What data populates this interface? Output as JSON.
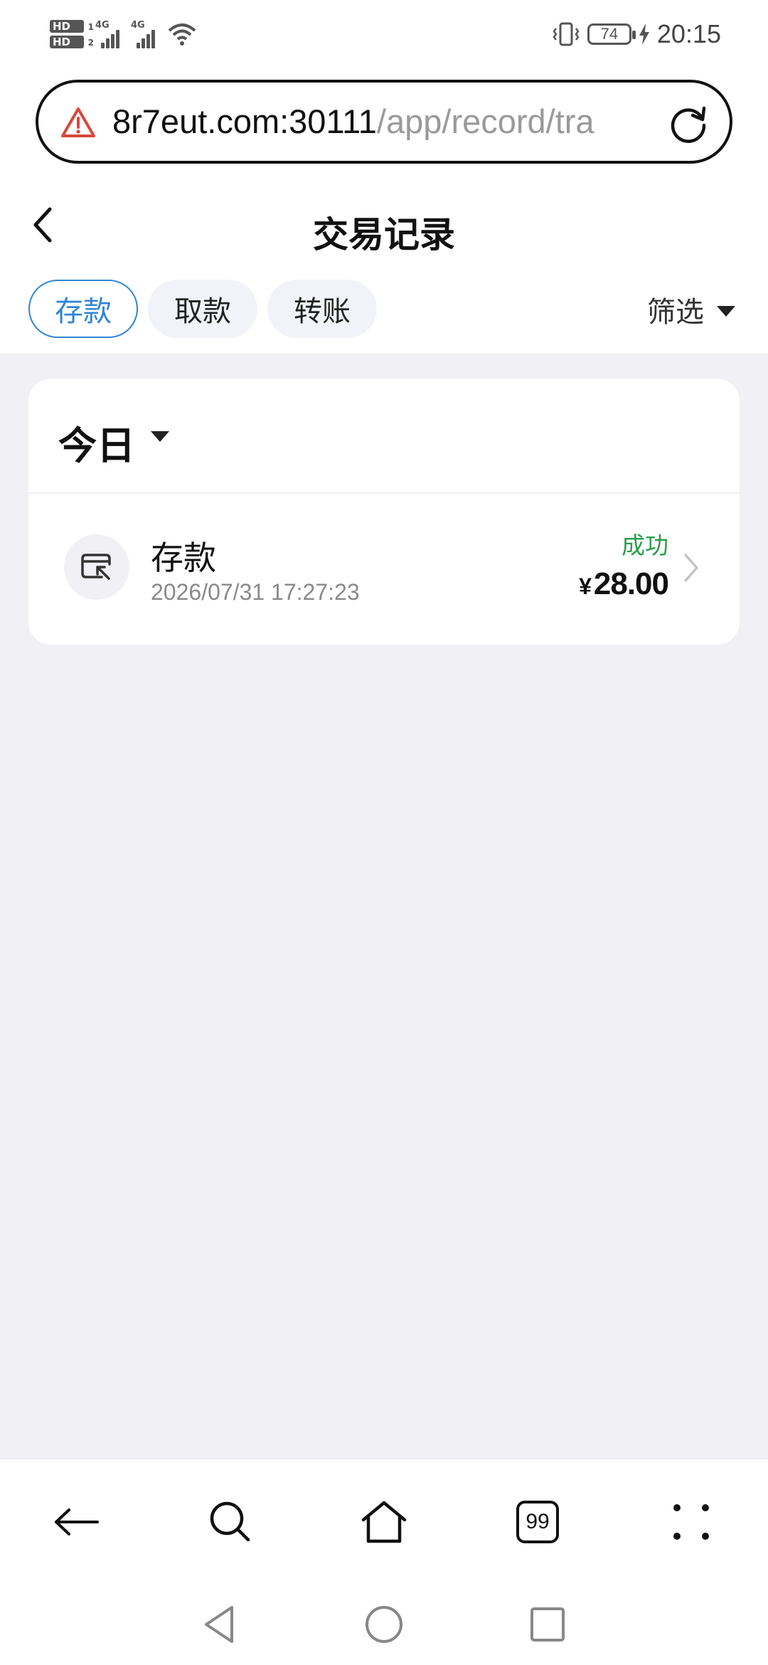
{
  "status_bar": {
    "hd1": "HD",
    "hd1_slot": "1",
    "hd2": "HD",
    "hd2_slot": "2",
    "net1": "4G",
    "net2": "4G",
    "battery": "74",
    "time": "20:15",
    "icons": [
      "signal-icon",
      "wifi-icon",
      "vibrate-icon",
      "battery-icon",
      "charging-icon"
    ]
  },
  "url_bar": {
    "host": "8r7eut.com:30111",
    "path": "/app/record/tra",
    "warning_icon": "warning-triangle-icon",
    "reload_icon": "reload-icon",
    "warning_color": "#d9473a"
  },
  "header": {
    "title": "交易记录",
    "back_icon": "chevron-left-icon"
  },
  "tabs": [
    {
      "label": "存款",
      "active": true
    },
    {
      "label": "取款",
      "active": false
    },
    {
      "label": "转账",
      "active": false
    }
  ],
  "filter": {
    "label": "筛选",
    "icon": "caret-down-icon"
  },
  "records": {
    "period_label": "今日",
    "items": [
      {
        "type": "存款",
        "datetime": "2026/07/31 17:27:23",
        "status": "成功",
        "currency": "¥",
        "amount": "28.00",
        "icon": "deposit-icon"
      }
    ]
  },
  "colors": {
    "accent": "#2f86d6",
    "success": "#2a9d4a",
    "background": "#f0f0f5"
  },
  "browser_bar": {
    "tab_count": "99",
    "icons": [
      "back-arrow-icon",
      "search-icon",
      "home-icon",
      "tabs-icon",
      "more-icon"
    ]
  },
  "system_nav": {
    "icons": [
      "nav-back-icon",
      "nav-home-icon",
      "nav-recents-icon"
    ]
  }
}
